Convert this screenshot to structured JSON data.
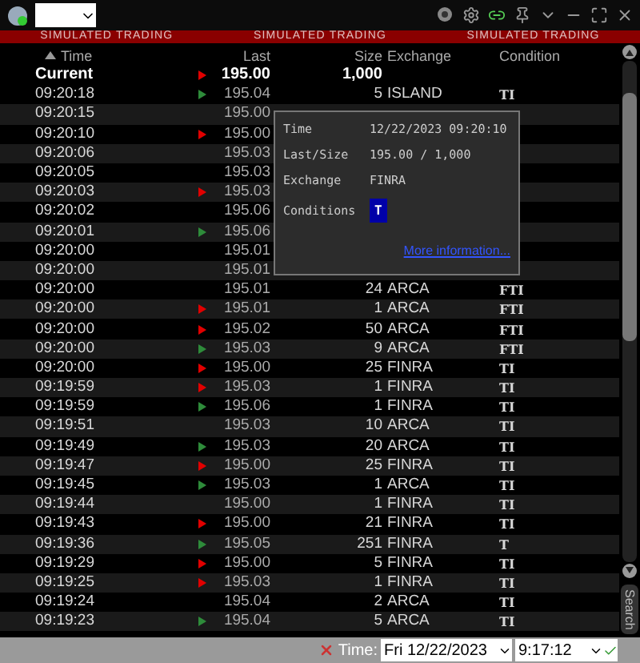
{
  "banner": [
    "SIMULATED TRADING",
    "SIMULATED TRADING",
    "SIMULATED TRADING"
  ],
  "columns": [
    "Time",
    "Last",
    "Size",
    "Exchange",
    "Condition"
  ],
  "current": {
    "time": "Current",
    "color": "#e00000",
    "last": "195.00",
    "size": "1,000"
  },
  "rows": [
    {
      "time": "09:20:18",
      "color": "#2e8b3a",
      "last": "195.04",
      "size": "5",
      "exchange": "ISLAND",
      "condition": "TI"
    },
    {
      "time": "09:20:15",
      "last": "195.00"
    },
    {
      "time": "09:20:10",
      "color": "#e00000",
      "last": "195.00"
    },
    {
      "time": "09:20:06",
      "last": "195.03"
    },
    {
      "time": "09:20:05",
      "last": "195.03"
    },
    {
      "time": "09:20:03",
      "color": "#e00000",
      "last": "195.03"
    },
    {
      "time": "09:20:02",
      "last": "195.06"
    },
    {
      "time": "09:20:01",
      "color": "#2e8b3a",
      "last": "195.06"
    },
    {
      "time": "09:20:00",
      "last": "195.01"
    },
    {
      "time": "09:20:00",
      "last": "195.01"
    },
    {
      "time": "09:20:00",
      "last": "195.01",
      "size": "24",
      "exchange": "ARCA",
      "condition": "FTI"
    },
    {
      "time": "09:20:00",
      "color": "#e00000",
      "last": "195.01",
      "size": "1",
      "exchange": "ARCA",
      "condition": "FTI"
    },
    {
      "time": "09:20:00",
      "color": "#e00000",
      "last": "195.02",
      "size": "50",
      "exchange": "ARCA",
      "condition": "FTI"
    },
    {
      "time": "09:20:00",
      "color": "#2e8b3a",
      "last": "195.03",
      "size": "9",
      "exchange": "ARCA",
      "condition": "FTI"
    },
    {
      "time": "09:20:00",
      "color": "#e00000",
      "last": "195.00",
      "size": "25",
      "exchange": "FINRA",
      "condition": "TI"
    },
    {
      "time": "09:19:59",
      "color": "#e00000",
      "last": "195.03",
      "size": "1",
      "exchange": "FINRA",
      "condition": "TI"
    },
    {
      "time": "09:19:59",
      "color": "#2e8b3a",
      "last": "195.06",
      "size": "1",
      "exchange": "FINRA",
      "condition": "TI"
    },
    {
      "time": "09:19:51",
      "last": "195.03",
      "size": "10",
      "exchange": "ARCA",
      "condition": "TI"
    },
    {
      "time": "09:19:49",
      "color": "#2e8b3a",
      "last": "195.03",
      "size": "20",
      "exchange": "ARCA",
      "condition": "TI"
    },
    {
      "time": "09:19:47",
      "color": "#e00000",
      "last": "195.00",
      "size": "25",
      "exchange": "FINRA",
      "condition": "TI"
    },
    {
      "time": "09:19:45",
      "color": "#2e8b3a",
      "last": "195.03",
      "size": "1",
      "exchange": "ARCA",
      "condition": "TI"
    },
    {
      "time": "09:19:44",
      "last": "195.00",
      "size": "1",
      "exchange": "FINRA",
      "condition": "TI"
    },
    {
      "time": "09:19:43",
      "color": "#e00000",
      "last": "195.00",
      "size": "21",
      "exchange": "FINRA",
      "condition": "TI"
    },
    {
      "time": "09:19:36",
      "color": "#2e8b3a",
      "last": "195.05",
      "size": "251",
      "exchange": "FINRA",
      "condition": "T"
    },
    {
      "time": "09:19:29",
      "color": "#e00000",
      "last": "195.00",
      "size": "5",
      "exchange": "FINRA",
      "condition": "TI"
    },
    {
      "time": "09:19:25",
      "color": "#e00000",
      "last": "195.03",
      "size": "1",
      "exchange": "FINRA",
      "condition": "TI"
    },
    {
      "time": "09:19:24",
      "last": "195.04",
      "size": "2",
      "exchange": "ARCA",
      "condition": "TI"
    },
    {
      "time": "09:19:23",
      "color": "#2e8b3a",
      "last": "195.04",
      "size": "5",
      "exchange": "ARCA",
      "condition": "TI"
    }
  ],
  "tooltip": {
    "fields": [
      {
        "label": "Time",
        "value": "12/22/2023 09:20:10"
      },
      {
        "label": "Last/Size",
        "value": "195.00 / 1,000"
      },
      {
        "label": "Exchange",
        "value": "FINRA"
      }
    ],
    "conditions_label": "Conditions",
    "conditions_value": "T",
    "link": "More information..."
  },
  "footer": {
    "label": "Time:",
    "date": "Fri 12/22/2023",
    "time": "9:17:12"
  },
  "search_tab": "Search"
}
